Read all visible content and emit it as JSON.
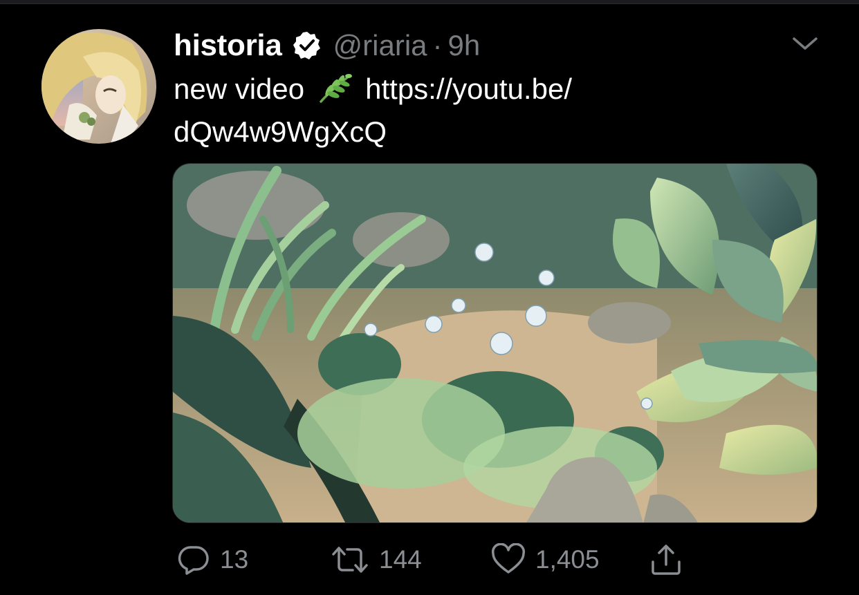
{
  "tweet": {
    "display_name": "historia",
    "handle": "@riaria",
    "separator": "·",
    "time": "9h",
    "text_line1_prefix": "new video",
    "text_emoji": "herb",
    "text_line1_link": "https://youtu.be/",
    "text_line2_link": "dQw4w9WgXcQ",
    "verified": true
  },
  "icons": {
    "verified": "verified-badge-icon",
    "caret": "chevron-down-icon",
    "reply": "reply-icon",
    "retweet": "retweet-icon",
    "like": "heart-icon",
    "share": "share-icon"
  },
  "actions": {
    "replies": "13",
    "retweets": "144",
    "likes": "1,405"
  },
  "colors": {
    "background": "#000000",
    "text": "#ffffff",
    "secondary": "#7a7d80",
    "icon": "#8b8e92"
  }
}
